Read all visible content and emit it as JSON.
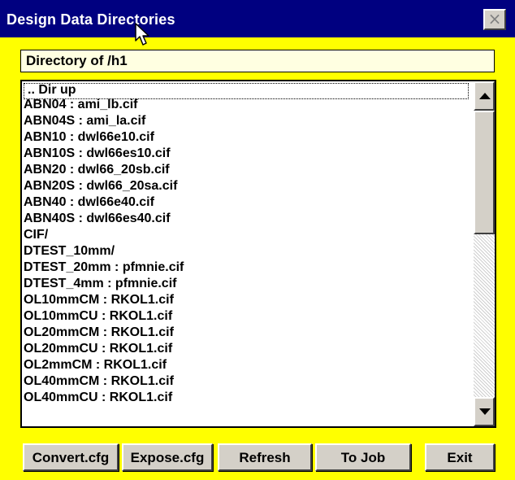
{
  "window": {
    "title": "Design Data Directories",
    "close_symbol": "×"
  },
  "path": {
    "label": "Directory of /h1"
  },
  "list": {
    "items": [
      ".. Dir up",
      "ABN04 : ami_lb.cif",
      "ABN04S : ami_la.cif",
      "ABN10 : dwl66e10.cif",
      "ABN10S : dwl66es10.cif",
      "ABN20 : dwl66_20sb.cif",
      "ABN20S : dwl66_20sa.cif",
      "ABN40 : dwl66e40.cif",
      "ABN40S : dwl66es40.cif",
      "CIF/",
      "DTEST_10mm/",
      "DTEST_20mm : pfmnie.cif",
      "DTEST_4mm : pfmnie.cif",
      "OL10mmCM : RKOL1.cif",
      "OL10mmCU : RKOL1.cif",
      "OL20mmCM : RKOL1.cif",
      "OL20mmCU : RKOL1.cif",
      "OL2mmCM : RKOL1.cif",
      "OL40mmCM : RKOL1.cif",
      "OL40mmCU : RKOL1.cif"
    ]
  },
  "buttons": {
    "convert": "Convert.cfg",
    "expose": "Expose.cfg",
    "refresh": "Refresh",
    "to_job": "To Job",
    "exit": "Exit"
  },
  "colors": {
    "title_bar": "#000080",
    "window_bg": "#ffff00",
    "path_bg": "#ffffe1"
  }
}
